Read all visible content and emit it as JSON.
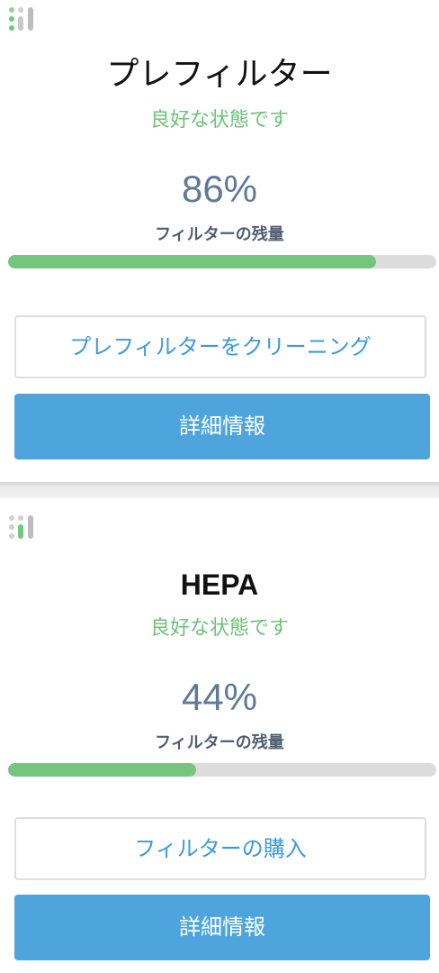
{
  "colors": {
    "status_green": "#6dc27a",
    "progress_fill": "#74c67e",
    "progress_track": "#dcdcdc",
    "link_blue": "#3d9ad8",
    "primary_blue": "#4ea5dd",
    "percent_gray_blue": "#5e7a96"
  },
  "filters": [
    {
      "icon": "filter-level-icon",
      "title": "プレフィルター",
      "status": "良好な状態です",
      "percent_label": "86%",
      "remaining_fraction": 0.86,
      "remaining_label": "フィルターの残量",
      "action_label": "プレフィルターをクリーニング",
      "details_label": "詳細情報"
    },
    {
      "icon": "filter-level-icon",
      "title": "HEPA",
      "status": "良好な状態です",
      "percent_label": "44%",
      "remaining_fraction": 0.44,
      "remaining_label": "フィルターの残量",
      "action_label": "フィルターの購入",
      "details_label": "詳細情報"
    }
  ]
}
